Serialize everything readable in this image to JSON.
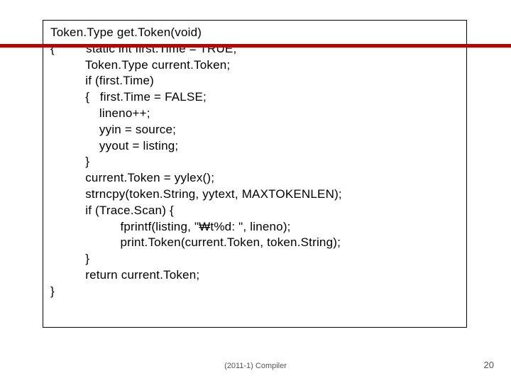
{
  "code": {
    "l0": "Token.Type get.Token(void)",
    "l1": "{         static int first.Time = TRUE;",
    "l2": "          Token.Type current.Token;",
    "l3": "          if (first.Time)",
    "l4": "          {   first.Time = FALSE;",
    "l5": "              lineno++;",
    "l6": "              yyin = source;",
    "l7": "              yyout = listing;",
    "l8": "          }",
    "l9": "          current.Token = yylex();",
    "l10": "          strncpy(token.String, yytext, MAXTOKENLEN);",
    "l11": "          if (Trace.Scan) {",
    "l12": "                    fprintf(listing, \"₩t%d: \", lineno);",
    "l13": "                    print.Token(current.Token, token.String);",
    "l14": "          }",
    "l15": "          return current.Token;",
    "l16": "}"
  },
  "footer": {
    "center": "(2011-1) Compiler",
    "page": "20"
  }
}
